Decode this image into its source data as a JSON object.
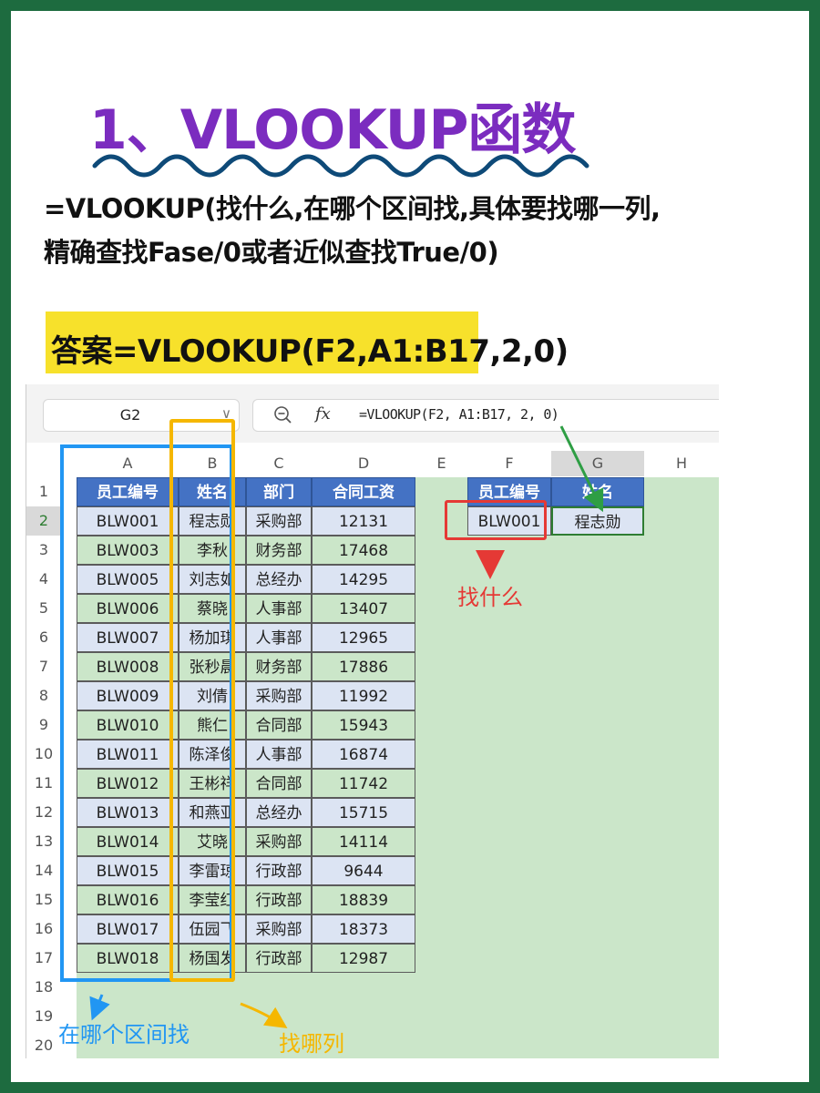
{
  "title": "1、VLOOKUP函数",
  "syntax_line1": "=VLOOKUP(找什么,在哪个区间找,具体要找哪一列,",
  "syntax_line2": "精确查找Fase/0或者近似查找True/0)",
  "answer": "答案=VLOOKUP(F2,A1:B17,2,0)",
  "namebox": {
    "value": "G2",
    "arrow": "∨"
  },
  "formula_bar": {
    "zoom_icon": "magnifier-icon",
    "fx_label": "fx",
    "formula": "=VLOOKUP(F2, A1:B17, 2, 0)"
  },
  "columns": [
    "A",
    "B",
    "C",
    "D",
    "E",
    "F",
    "G",
    "H"
  ],
  "rows": [
    "1",
    "2",
    "3",
    "4",
    "5",
    "6",
    "7",
    "8",
    "9",
    "10",
    "11",
    "12",
    "13",
    "14",
    "15",
    "16",
    "17",
    "18",
    "19",
    "20"
  ],
  "table": {
    "headers": [
      "员工编号",
      "姓名",
      "部门",
      "合同工资"
    ],
    "rows": [
      [
        "BLW001",
        "程志勋",
        "采购部",
        "12131"
      ],
      [
        "BLW003",
        "李秋",
        "财务部",
        "17468"
      ],
      [
        "BLW005",
        "刘志如",
        "总经办",
        "14295"
      ],
      [
        "BLW006",
        "蔡晓",
        "人事部",
        "13407"
      ],
      [
        "BLW007",
        "杨加琪",
        "人事部",
        "12965"
      ],
      [
        "BLW008",
        "张秒晨",
        "财务部",
        "17886"
      ],
      [
        "BLW009",
        "刘倩",
        "采购部",
        "11992"
      ],
      [
        "BLW010",
        "熊仁",
        "合同部",
        "15943"
      ],
      [
        "BLW011",
        "陈泽俊",
        "人事部",
        "16874"
      ],
      [
        "BLW012",
        "王彬祥",
        "合同部",
        "11742"
      ],
      [
        "BLW013",
        "和燕亚",
        "总经办",
        "15715"
      ],
      [
        "BLW014",
        "艾晓",
        "采购部",
        "14114"
      ],
      [
        "BLW015",
        "李雷琼",
        "行政部",
        "9644"
      ],
      [
        "BLW016",
        "李莹红",
        "行政部",
        "18839"
      ],
      [
        "BLW017",
        "伍园飞",
        "采购部",
        "18373"
      ],
      [
        "BLW018",
        "杨国发",
        "行政部",
        "12987"
      ]
    ]
  },
  "lookup": {
    "headers": [
      "员工编号",
      "姓名"
    ],
    "key": "BLW001",
    "result": "程志勋"
  },
  "annotations": {
    "find_what": "找什么",
    "which_range": "在哪个区间找",
    "which_column": "找哪列"
  },
  "colors": {
    "title": "#7b2cbf",
    "header_blue": "#4472c4",
    "highlight_yellow": "#f7e12b",
    "green_bg": "#cbe6c9",
    "red": "#e53935",
    "blue_box": "#2196f3",
    "orange_box": "#f5b700",
    "arrow_green": "#2e9e44"
  }
}
